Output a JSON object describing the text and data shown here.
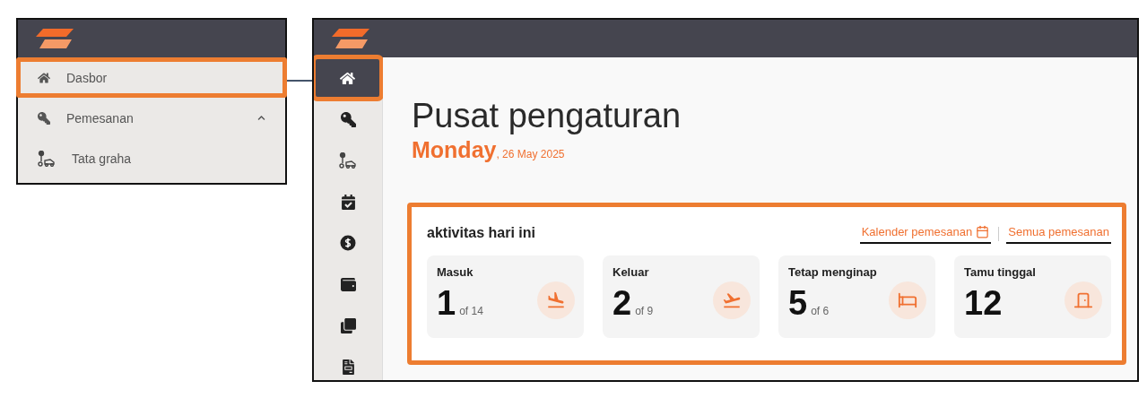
{
  "left_panel": {
    "menu": [
      {
        "kind": "home",
        "label": "Dasbor",
        "selected": true
      },
      {
        "kind": "key",
        "label": "Pemesanan",
        "selected": false,
        "expanded": true
      },
      {
        "kind": "housekeeping",
        "label": "Tata graha",
        "selected": false
      }
    ]
  },
  "right_panel": {
    "sidebar": [
      {
        "kind": "home",
        "selected": true
      },
      {
        "kind": "key",
        "selected": false
      },
      {
        "kind": "housekeeping",
        "selected": false
      },
      {
        "kind": "calendar",
        "selected": false
      },
      {
        "kind": "money",
        "selected": false
      },
      {
        "kind": "wallet",
        "selected": false
      },
      {
        "kind": "copies",
        "selected": false
      },
      {
        "kind": "report",
        "selected": false
      }
    ],
    "title": "Pusat pengaturan",
    "day": "Monday",
    "date": ", 26 May 2025",
    "activity": {
      "title": "aktivitas hari ini",
      "links": [
        {
          "label": "Kalender pemesanan",
          "kind": "calendar"
        },
        {
          "label": "Semua pemesanan",
          "kind": "plain"
        }
      ],
      "stats": [
        {
          "kind": "arrival",
          "label": "Masuk",
          "value": "1",
          "total": "of 14"
        },
        {
          "kind": "departure",
          "label": "Keluar",
          "value": "2",
          "total": "of 9"
        },
        {
          "kind": "stay",
          "label": "Tetap menginap",
          "value": "5",
          "total": "of 6"
        },
        {
          "kind": "guests",
          "label": "Tamu tinggal",
          "value": "12"
        }
      ]
    }
  }
}
